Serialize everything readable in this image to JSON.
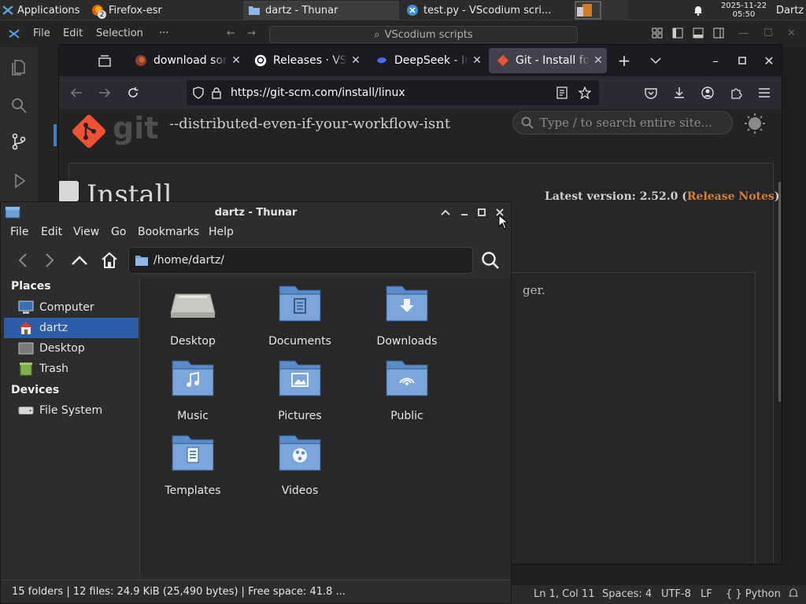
{
  "panel": {
    "applications": "Applications",
    "tasks": [
      {
        "label": "Firefox-esr",
        "badge": "2",
        "icon": "firefox-icon"
      },
      {
        "label": "dartz - Thunar",
        "icon": "folder-icon"
      },
      {
        "label": "test.py - VScodium scri...",
        "icon": "vscodium-icon"
      }
    ],
    "clock_date": "2025-11-22",
    "clock_time": "05:50",
    "user": "Dartz"
  },
  "vscodium": {
    "menu": [
      "File",
      "Edit",
      "Selection",
      "···"
    ],
    "search": "VScodium scripts",
    "status": {
      "position": "Ln 1, Col 11",
      "spaces": "Spaces: 4",
      "encoding": "UTF-8",
      "eol": "LF",
      "language": "{ }  Python"
    }
  },
  "firefox": {
    "tabs": [
      {
        "label": "download som",
        "icon": "firefox-icon",
        "color": "#e66000"
      },
      {
        "label": "Releases · VSC",
        "icon": "github-icon",
        "color": "#ffffff"
      },
      {
        "label": "DeepSeek - Inv",
        "icon": "deepseek-icon",
        "color": "#4d6bfe"
      },
      {
        "label": "Git - Install for",
        "icon": "git-icon",
        "color": "#f05133"
      }
    ],
    "url": "https://git-scm.com/install/linux",
    "page": {
      "logo_word": "git",
      "tagline": "--distributed-even-if-your-workflow-isnt",
      "search_placeholder": "Type / to search entire site...",
      "heading": "Install",
      "latest_label": "Latest version: 2.52.0 (",
      "release_notes": "Release Notes",
      "latest_close": ")",
      "fragment": "ger."
    }
  },
  "thunar": {
    "title": "dartz - Thunar",
    "menu": [
      "File",
      "Edit",
      "View",
      "Go",
      "Bookmarks",
      "Help"
    ],
    "location": "/home/dartz/",
    "sidebar": {
      "places_header": "Places",
      "places": [
        {
          "label": "Computer",
          "icon": "computer-icon"
        },
        {
          "label": "dartz",
          "icon": "home-icon",
          "selected": true
        },
        {
          "label": "Desktop",
          "icon": "desktop-icon"
        },
        {
          "label": "Trash",
          "icon": "trash-icon"
        }
      ],
      "devices_header": "Devices",
      "devices": [
        {
          "label": "File System",
          "icon": "drive-icon"
        }
      ]
    },
    "folders": [
      {
        "label": "Desktop",
        "icon": "desktop-folder-icon"
      },
      {
        "label": "Documents",
        "icon": "documents-folder-icon"
      },
      {
        "label": "Downloads",
        "icon": "downloads-folder-icon"
      },
      {
        "label": "Music",
        "icon": "music-folder-icon"
      },
      {
        "label": "Pictures",
        "icon": "pictures-folder-icon"
      },
      {
        "label": "Public",
        "icon": "public-folder-icon"
      },
      {
        "label": "Templates",
        "icon": "templates-folder-icon"
      },
      {
        "label": "Videos",
        "icon": "videos-folder-icon"
      }
    ],
    "status": "15 folders  |  12 files: 24.9 KiB (25,490 bytes)  |  Free space: 41.8 ..."
  },
  "colors": {
    "selection": "#2c5da8",
    "folder": "#6f9fd8",
    "git_orange": "#f05133",
    "release_notes": "#d1803a"
  }
}
